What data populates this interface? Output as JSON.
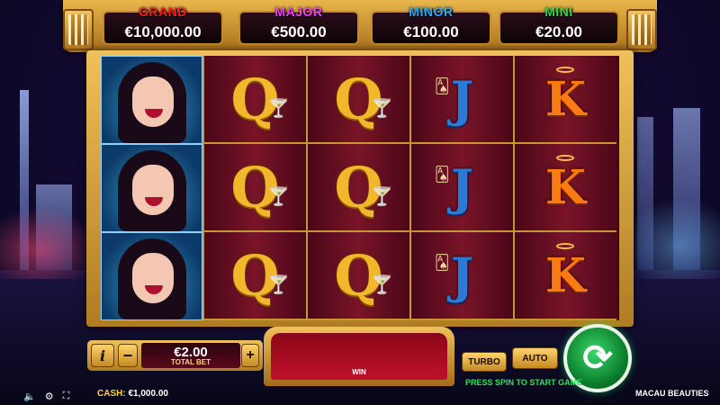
{
  "jackpots": [
    {
      "label": "GRAND",
      "value": "€10,000.00",
      "color": "#ff1a1a"
    },
    {
      "label": "MAJOR",
      "value": "€500.00",
      "color": "#ff3cff"
    },
    {
      "label": "MINOR",
      "value": "€100.00",
      "color": "#29a8ff"
    },
    {
      "label": "MINI",
      "value": "€20.00",
      "color": "#2ed84a"
    }
  ],
  "reels": [
    [
      "woman",
      "woman",
      "woman"
    ],
    [
      "Q",
      "Q",
      "Q"
    ],
    [
      "Q",
      "Q",
      "Q"
    ],
    [
      "J",
      "J",
      "J"
    ],
    [
      "K",
      "K",
      "K"
    ]
  ],
  "controls": {
    "info_label": "i",
    "minus_label": "−",
    "plus_label": "+",
    "bet_value": "€2.00",
    "bet_label": "TOTAL BET",
    "win_label": "WIN",
    "turbo_label": "TURBO",
    "auto_label": "AUTO",
    "spin_hint": "PRESS SPIN TO START GAME"
  },
  "footer": {
    "cash_label": "CASH:",
    "cash_value": "€1,000.00",
    "game_title": "MACAU BEAUTIES"
  },
  "icons": [
    "sound-icon",
    "settings-icon",
    "fullscreen-icon",
    "info-icon",
    "spin-icon"
  ]
}
